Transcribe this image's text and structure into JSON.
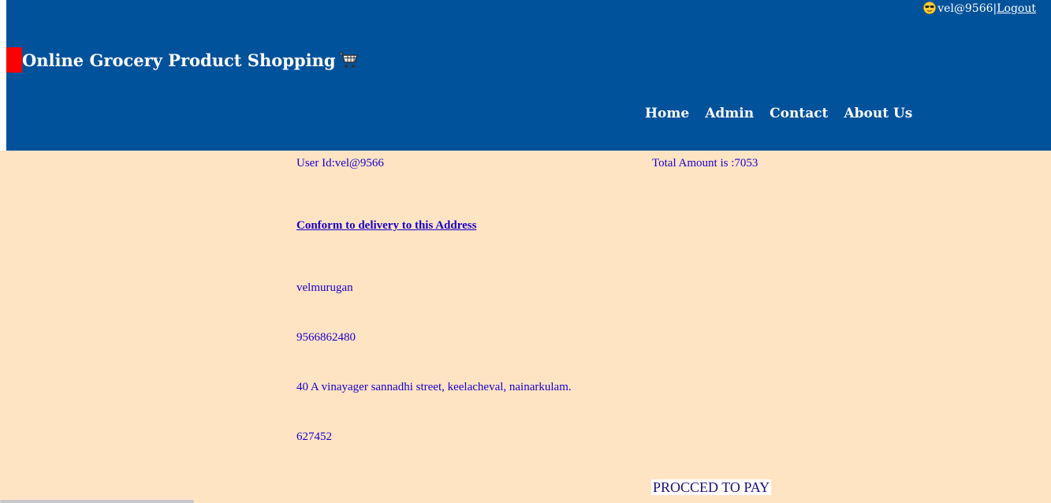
{
  "header": {
    "user_label": "vel@9566",
    "separator": "|",
    "logout_label": "Logout",
    "title": "Online Grocery Product Shopping",
    "nav": [
      {
        "label": "Home"
      },
      {
        "label": "Admin"
      },
      {
        "label": "Contact"
      },
      {
        "label": "About Us"
      }
    ]
  },
  "order": {
    "user_id_text": "User Id:vel@9566",
    "total_text": "Total Amount is :7053",
    "confirm_text": "Conform to delivery to this Address",
    "name": "velmurugan",
    "phone": "9566862480",
    "address": "40 A vinayager sannadhi street, keelacheval, nainarkulam.",
    "pincode": "627452",
    "pay_label": "PROCCED TO PAY"
  },
  "colors": {
    "header_bg": "#00529b",
    "page_bg": "#ffe4c4",
    "brand_marker": "#ff0000",
    "content_text": "#1800cc"
  },
  "icons": {
    "user": "sunglasses-face-icon",
    "title": "shopping-cart-icon"
  }
}
